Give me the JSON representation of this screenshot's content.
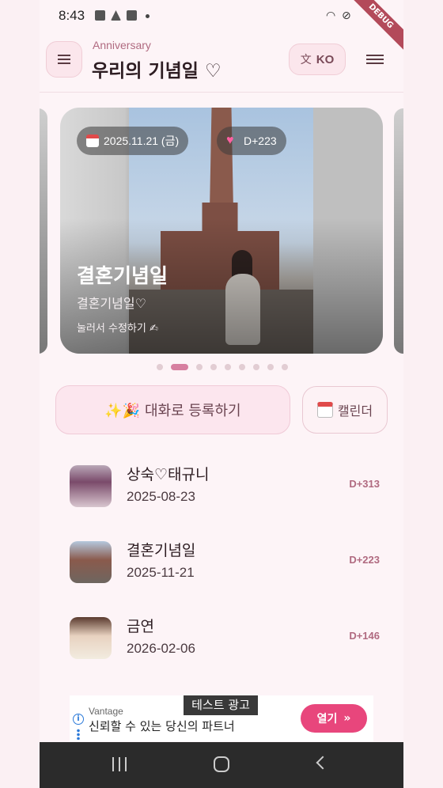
{
  "status": {
    "time": "8:43",
    "debug": "DEBUG"
  },
  "header": {
    "subtitle": "Anniversary",
    "title": "우리의 기념일 ♡",
    "lang": "KO"
  },
  "carousel": {
    "date_chip": "2025.11.21 (금)",
    "dday_chip": "D+223",
    "title": "결혼기념일",
    "subtitle": "결혼기념일♡",
    "hint": "눌러서 수정하기 ✍",
    "page_count": 9,
    "active_page": 2
  },
  "actions": {
    "chat_label": "✨🎉 대화로 등록하기",
    "calendar_label": "캘린더"
  },
  "list": [
    {
      "name": "상숙♡태규니",
      "date": "2025-08-23",
      "dday": "D+313"
    },
    {
      "name": "결혼기념일",
      "date": "2025-11-21",
      "dday": "D+223"
    },
    {
      "name": "금연",
      "date": "2026-02-06",
      "dday": "D+146"
    }
  ],
  "ad": {
    "label": "테스트 광고",
    "brand": "Vantage",
    "text": "신뢰할 수 있는 당신의 파트너",
    "cta": "열기"
  }
}
